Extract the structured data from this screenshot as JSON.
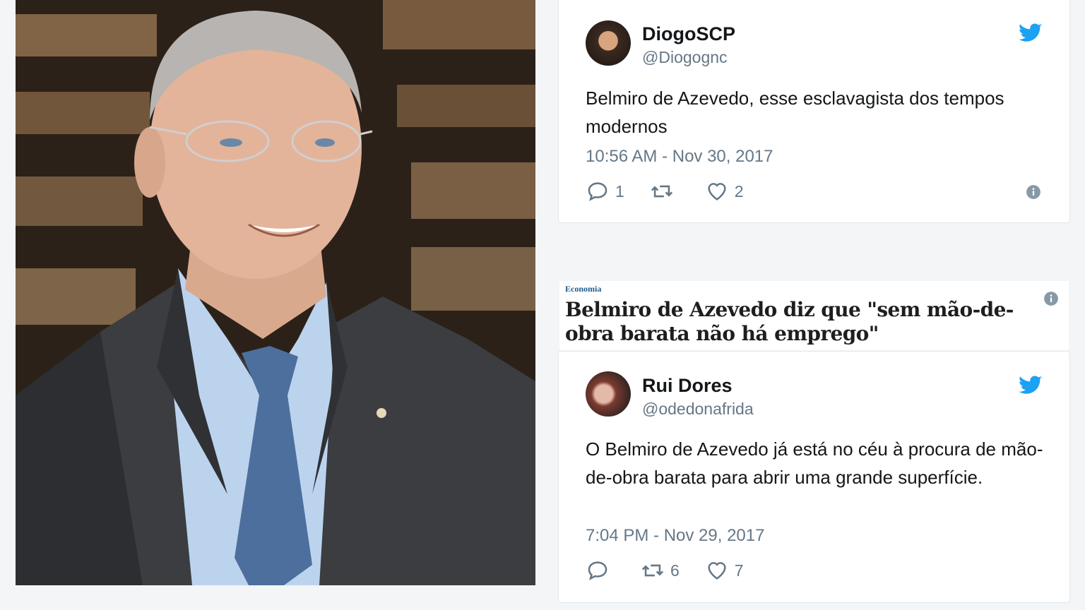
{
  "tweet1": {
    "name": "DiogoSCP",
    "handle": "@Diogognc",
    "text": "Belmiro de Azevedo, esse esclavagista dos tempos modernos",
    "time": "10:56 AM - Nov 30, 2017",
    "replies": "1",
    "retweets": "",
    "likes": "2"
  },
  "article": {
    "section": "Economia",
    "headline": "Belmiro de Azevedo diz que \"sem mão-de-obra barata não há emprego\""
  },
  "tweet2": {
    "name": "Rui Dores",
    "handle": "@odedonafrida",
    "text": "O Belmiro de Azevedo já está no céu à procura de mão-de-obra barata para abrir uma grande superfície.",
    "time": "7:04 PM - Nov 29, 2017",
    "replies": "",
    "retweets": "6",
    "likes": "7"
  },
  "colors": {
    "twitter_blue": "#1da1f2",
    "muted": "#657786",
    "text": "#14171a"
  },
  "icons": [
    "twitter-bird-icon",
    "reply-icon",
    "retweet-icon",
    "heart-icon",
    "info-icon"
  ]
}
